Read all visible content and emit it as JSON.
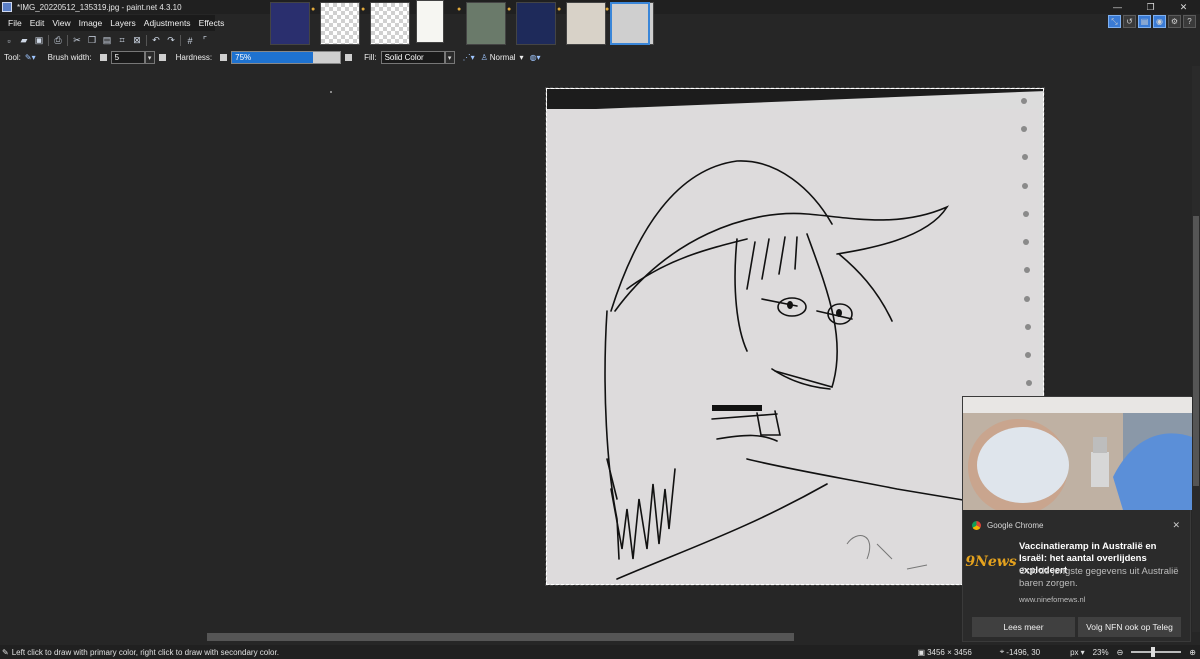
{
  "titlebar": {
    "title": "*IMG_20220512_135319.jpg - paint.net 4.3.10",
    "minimize": "—",
    "maximize": "❐",
    "close": "✕"
  },
  "menu": [
    "File",
    "Edit",
    "View",
    "Image",
    "Layers",
    "Adjustments",
    "Effects"
  ],
  "toolbar": {
    "tool_label": "Tool:",
    "brush_width_label": "Brush width:",
    "brush_width_value": "5",
    "hardness_label": "Hardness:",
    "hardness_value": "75%",
    "hardness_fraction": 0.75,
    "fill_label": "Fill:",
    "fill_value": "Solid Color",
    "blend_mode": "Normal"
  },
  "statusbar": {
    "hint": "Left click to draw with primary color, right click to draw with secondary color.",
    "image_size": "3456 × 3456",
    "cursor_pos": "-1496, 30",
    "unit": "px",
    "zoom": "23%"
  },
  "notification": {
    "app": "Google Chrome",
    "logo_text": "9News",
    "title": "Vaccinatieramp in Australië en Israël: het aantal overlijdens explodeert",
    "body": "Ook de jongste gegevens uit Australië baren zorgen.",
    "source": "www.ninefornews.nl",
    "button1": "Lees meer",
    "button2": "Volg NFN ook op Teleg"
  },
  "colors": {
    "accent": "#1e72d0",
    "selected_thumb": "#3a86d8",
    "background": "#262626"
  }
}
